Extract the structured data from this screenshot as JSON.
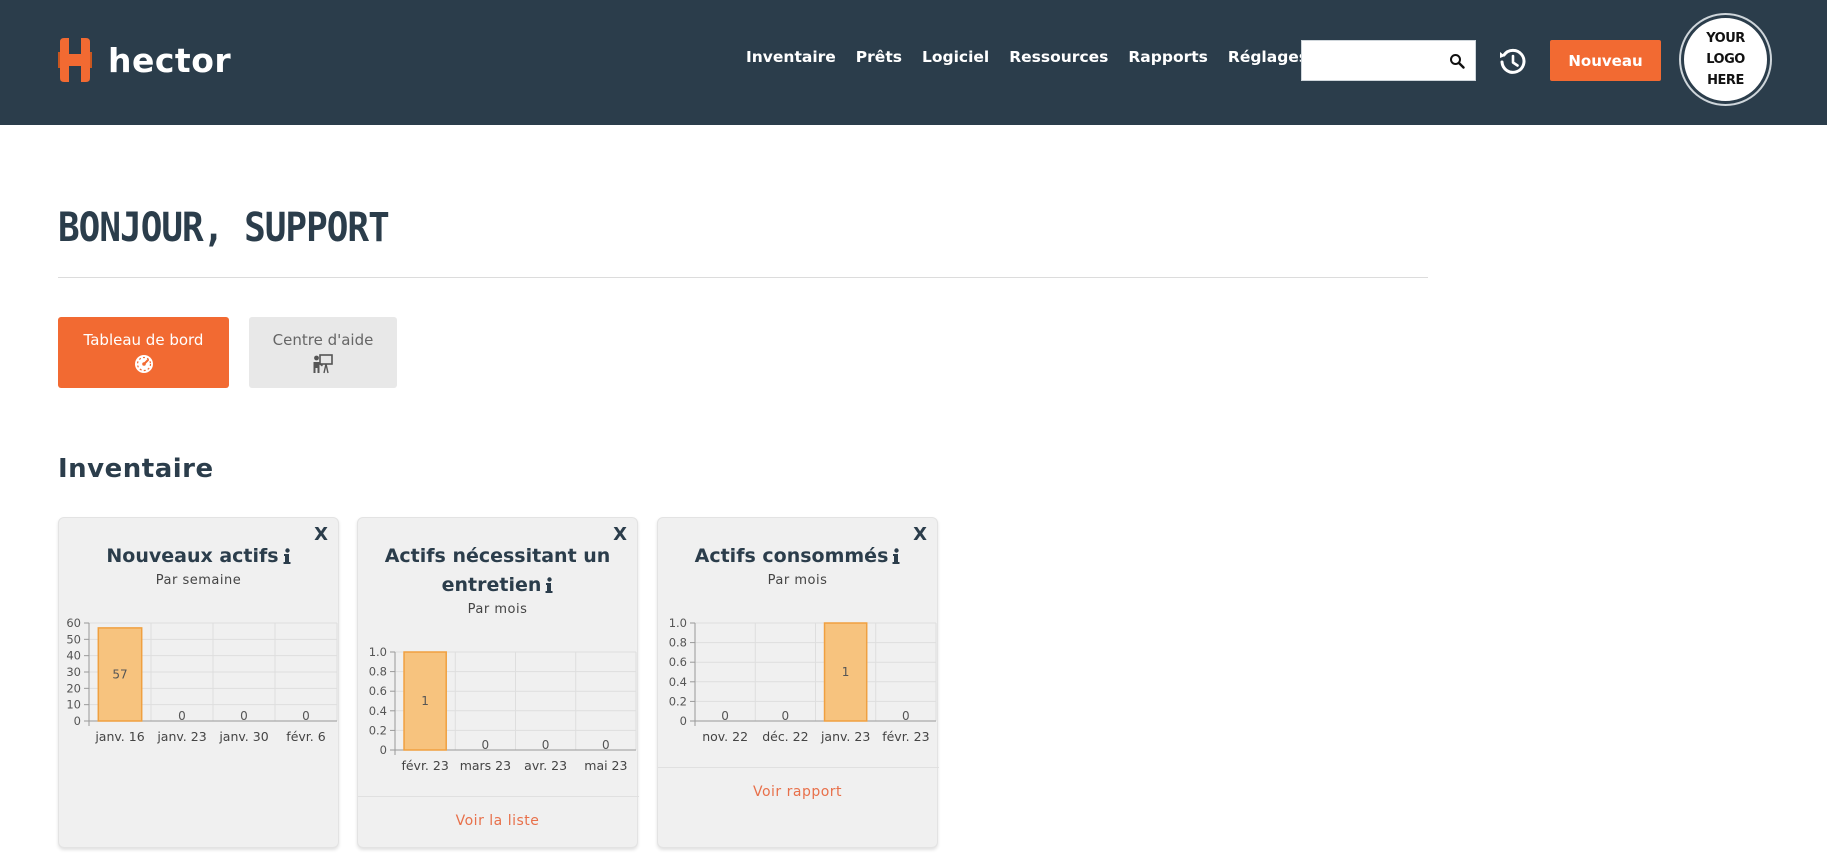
{
  "header": {
    "brand": "hector",
    "nav": [
      "Inventaire",
      "Prêts",
      "Logiciel",
      "Ressources",
      "Rapports",
      "Réglages"
    ],
    "search": {
      "value": "",
      "placeholder": ""
    },
    "new_label": "Nouveau",
    "logo_placeholder": [
      "YOUR",
      "LOGO",
      "HERE"
    ],
    "colors": {
      "bar": "#2b3d4b",
      "accent": "#f26a32"
    }
  },
  "greeting": "BONJOUR, SUPPORT",
  "tiles": {
    "dashboard": {
      "label": "Tableau de bord",
      "icon": "dashboard-gauge-icon"
    },
    "help": {
      "label": "Centre d'aide",
      "icon": "help-center-presenter-icon"
    }
  },
  "section_title": "Inventaire",
  "cards": [
    {
      "title": "Nouveaux actifs",
      "subtitle": "Par semaine",
      "link": "",
      "close": "X"
    },
    {
      "title_line1": "Actifs nécessitant un",
      "title_line2": "entretien",
      "subtitle": "Par mois",
      "link": "Voir la liste",
      "close": "X"
    },
    {
      "title": "Actifs consommés",
      "subtitle": "Par mois",
      "link": "Voir rapport",
      "close": "X"
    }
  ],
  "chart_data": [
    {
      "type": "bar",
      "categories": [
        "janv. 16",
        "janv. 23",
        "janv. 30",
        "févr. 6"
      ],
      "values": [
        57,
        0,
        0,
        0
      ],
      "ylim": [
        0,
        60
      ],
      "yticks": [
        "0",
        "10",
        "20",
        "30",
        "40",
        "50",
        "60"
      ],
      "grid": true,
      "bar_color": "#f7c37e"
    },
    {
      "type": "bar",
      "categories": [
        "févr. 23",
        "mars 23",
        "avr. 23",
        "mai 23"
      ],
      "values": [
        1,
        0,
        0,
        0
      ],
      "ylim": [
        0,
        1
      ],
      "yticks": [
        "0",
        "0.2",
        "0.4",
        "0.6",
        "0.8",
        "1.0"
      ],
      "grid": true,
      "bar_color": "#f7c37e"
    },
    {
      "type": "bar",
      "categories": [
        "nov. 22",
        "déc. 22",
        "janv. 23",
        "févr. 23"
      ],
      "values": [
        0,
        0,
        1,
        0
      ],
      "ylim": [
        0,
        1
      ],
      "yticks": [
        "0",
        "0.2",
        "0.4",
        "0.6",
        "0.8",
        "1.0"
      ],
      "grid": true,
      "bar_color": "#f7c37e"
    }
  ]
}
